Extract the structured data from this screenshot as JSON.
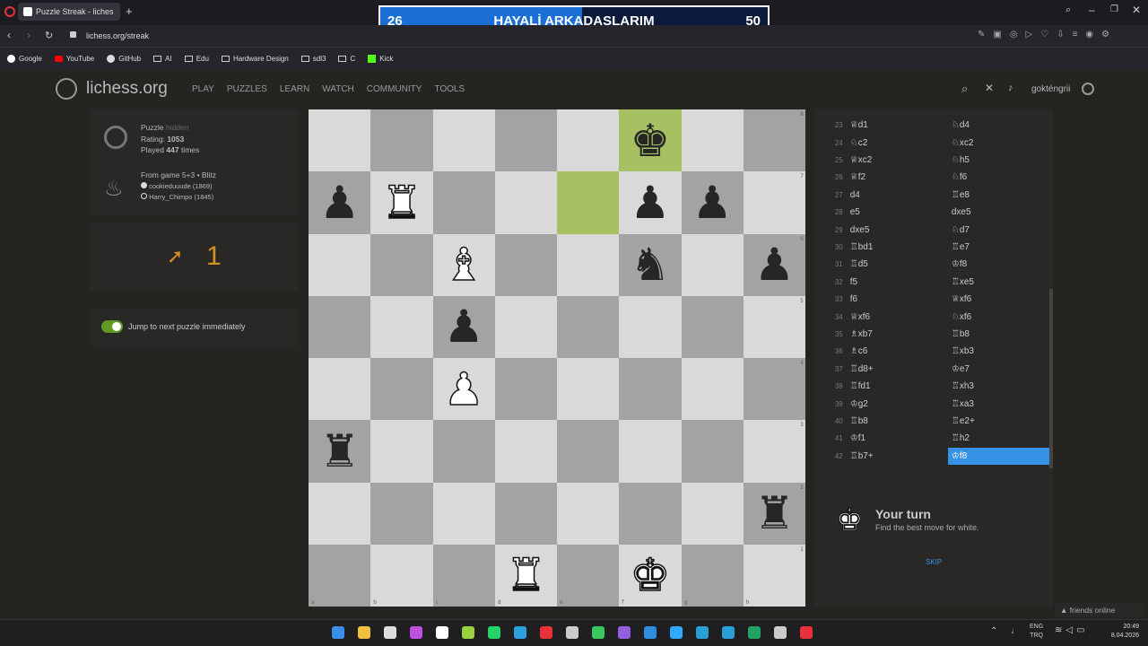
{
  "browser": {
    "tab_title": "Puzzle Streak - liches",
    "url": "lichess.org/streak",
    "bookmarks": [
      "Google",
      "YouTube",
      "GitHub",
      "AI",
      "Edu",
      "Hardware Design",
      "sdl3",
      "C",
      "Kick"
    ]
  },
  "overlay": {
    "left_score": "26",
    "title": "HAYALİ ARKADAŞLARIM",
    "right_score": "50",
    "progress_percent": 52
  },
  "header": {
    "logo": "lichess.org",
    "nav": [
      "PLAY",
      "PUZZLES",
      "LEARN",
      "WATCH",
      "COMMUNITY",
      "TOOLS"
    ],
    "username": "gokténgrii"
  },
  "puzzle": {
    "label": "Puzzle",
    "hidden_label": "hidden",
    "rating_label": "Rating:",
    "rating": "1053",
    "played_label": "Played",
    "played_count": "447",
    "played_suffix": "times",
    "from_game": "From game 5+3 • Blitz",
    "player_white": "cookieduuude (1869)",
    "player_black": "Harry_Chimpo (1845)"
  },
  "streak": {
    "count": "1"
  },
  "toggle": {
    "label": "Jump to next puzzle immediately",
    "on": true
  },
  "board": {
    "files": [
      "a",
      "b",
      "c",
      "d",
      "e",
      "f",
      "g",
      "h"
    ],
    "ranks": [
      "8",
      "7",
      "6",
      "5",
      "4",
      "3",
      "2",
      "1"
    ],
    "squares": [
      [
        "",
        "",
        "",
        "",
        "",
        "bK",
        "",
        ""
      ],
      [
        "bP",
        "wR",
        "",
        "",
        "",
        "bP",
        "bP",
        ""
      ],
      [
        "",
        "",
        "wB",
        "",
        "",
        "bN",
        "",
        "bP"
      ],
      [
        "",
        "",
        "bP",
        "",
        "",
        "",
        "",
        ""
      ],
      [
        "",
        "",
        "wP",
        "",
        "",
        "",
        "",
        ""
      ],
      [
        "bR",
        "",
        "",
        "",
        "",
        "",
        "",
        ""
      ],
      [
        "",
        "",
        "",
        "",
        "",
        "",
        "",
        "bR"
      ],
      [
        "",
        "",
        "",
        "wR",
        "",
        "wK",
        "",
        ""
      ]
    ],
    "highlights": [
      "f8",
      "e7"
    ],
    "piece_glyphs": {
      "K": "♚",
      "Q": "♛",
      "R": "♜",
      "B": "♝",
      "N": "♞",
      "P": "♟"
    }
  },
  "moves": [
    {
      "n": "23",
      "w": "♕d1",
      "b": "♘d4"
    },
    {
      "n": "24",
      "w": "♘c2",
      "b": "♘xc2"
    },
    {
      "n": "25",
      "w": "♕xc2",
      "b": "♘h5"
    },
    {
      "n": "26",
      "w": "♕f2",
      "b": "♘f6"
    },
    {
      "n": "27",
      "w": "d4",
      "b": "♖e8"
    },
    {
      "n": "28",
      "w": "e5",
      "b": "dxe5"
    },
    {
      "n": "29",
      "w": "dxe5",
      "b": "♘d7"
    },
    {
      "n": "30",
      "w": "♖bd1",
      "b": "♖e7"
    },
    {
      "n": "31",
      "w": "♖d5",
      "b": "♔f8"
    },
    {
      "n": "32",
      "w": "f5",
      "b": "♖xe5"
    },
    {
      "n": "33",
      "w": "f6",
      "b": "♕xf6"
    },
    {
      "n": "34",
      "w": "♕xf6",
      "b": "♘xf6"
    },
    {
      "n": "35",
      "w": "♗xb7",
      "b": "♖b8"
    },
    {
      "n": "36",
      "w": "♗c6",
      "b": "♖xb3"
    },
    {
      "n": "37",
      "w": "♖d8+",
      "b": "♔e7"
    },
    {
      "n": "38",
      "w": "♖fd1",
      "b": "♖xh3"
    },
    {
      "n": "39",
      "w": "♔g2",
      "b": "♖xa3"
    },
    {
      "n": "40",
      "w": "♖b8",
      "b": "♖e2+"
    },
    {
      "n": "41",
      "w": "♔f1",
      "b": "♖h2"
    },
    {
      "n": "42",
      "w": "♖b7+",
      "b": "♔f8"
    }
  ],
  "active_move": "42b",
  "status": {
    "title": "Your turn",
    "subtitle": "Find the best move for white.",
    "skip": "SKIP"
  },
  "friends": "friends online",
  "taskbar": {
    "lang": "ENG",
    "lang2": "TRQ",
    "time": "20:49",
    "date": "8.04.2026"
  },
  "colors": {
    "accent": "#3692e7",
    "highlight": "#a7c162",
    "overlay_bar": "#1a6fd6",
    "streak": "#d59020",
    "toggle": "#629924"
  }
}
